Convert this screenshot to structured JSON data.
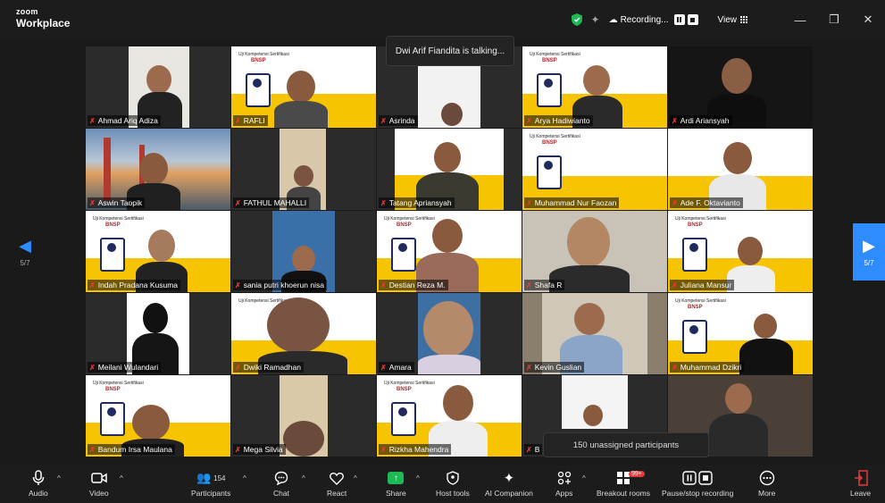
{
  "app": {
    "brand_top": "zoom",
    "brand_bottom": "Workplace"
  },
  "topbar": {
    "recording_label": "Recording...",
    "view_label": "View",
    "minimize": "—",
    "restore": "❐",
    "close": "✕"
  },
  "talking_banner": "Dwi Arif Fiandita is talking...",
  "pagination": {
    "left_page": "5/7",
    "right_page": "5/7"
  },
  "slide": {
    "title": "Uji Kompetensi Sertifikasi",
    "brand": "BNSP"
  },
  "participants": [
    {
      "name": "Ahmad Ariq Adiza"
    },
    {
      "name": "RAFLI"
    },
    {
      "name": "Asrinda"
    },
    {
      "name": "Arya Hadiwianto"
    },
    {
      "name": "Ardi Ariansyah"
    },
    {
      "name": "Aswin Taopik"
    },
    {
      "name": "FATHUL MAHALLI"
    },
    {
      "name": "Tatang Apriansyah"
    },
    {
      "name": "Muhammad Nur Faozan"
    },
    {
      "name": "Ade F. Oktavianto"
    },
    {
      "name": "Indah Pradana Kusuma"
    },
    {
      "name": "sania putri khoerun nisa"
    },
    {
      "name": "Destian Reza M."
    },
    {
      "name": "Shafa R"
    },
    {
      "name": "Juliana Mansur"
    },
    {
      "name": "Meilani Wulandari"
    },
    {
      "name": "Dwiki Ramadhan"
    },
    {
      "name": "Amara"
    },
    {
      "name": "Kevin Guslian"
    },
    {
      "name": "Muhammad Dzikri"
    },
    {
      "name": "Bandum Irsa Maulana"
    },
    {
      "name": "Mega Silvia"
    },
    {
      "name": "Rizkha Mahendra"
    },
    {
      "name": "B"
    },
    {
      "name": ""
    }
  ],
  "unassigned_notice": "150 unassigned participants",
  "toolbar": {
    "audio": "Audio",
    "video": "Video",
    "participants": "Participants",
    "participants_count": "154",
    "chat": "Chat",
    "react": "React",
    "share": "Share",
    "host_tools": "Host tools",
    "ai_companion": "AI Companion",
    "apps": "Apps",
    "breakout_rooms": "Breakout rooms",
    "breakout_badge": "99+",
    "pause_stop_recording": "Pause/stop recording",
    "more": "More",
    "leave": "Leave"
  },
  "colors": {
    "accent_blue": "#2d8cff",
    "share_green": "#1eb854",
    "muted_red": "#e23b3b",
    "slide_yellow": "#f6c400"
  }
}
